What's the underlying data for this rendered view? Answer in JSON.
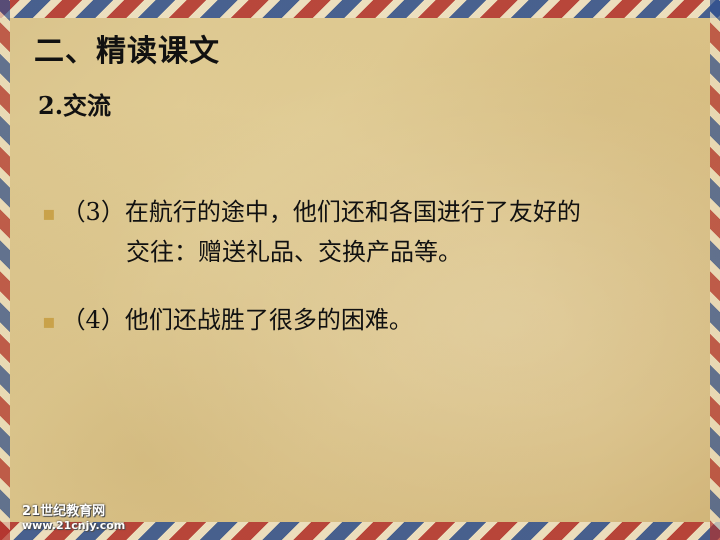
{
  "slide": {
    "title": "二、精读课文",
    "subtitle": "2.交流",
    "paragraphs": [
      {
        "line1": "（3）在航行的途中，他们还和各国进行了友好的",
        "line2": "交往：赠送礼品、交换产品等。"
      },
      {
        "line1": "（4）他们还战胜了很多的困难。"
      }
    ],
    "watermark": {
      "line1": "21世纪教育网",
      "line2": "www.21cnjy.com"
    }
  },
  "colors": {
    "paper": "#e0c98f",
    "stripe_red": "#b2302c",
    "stripe_blue": "#2e4f8f",
    "text": "#111111"
  }
}
